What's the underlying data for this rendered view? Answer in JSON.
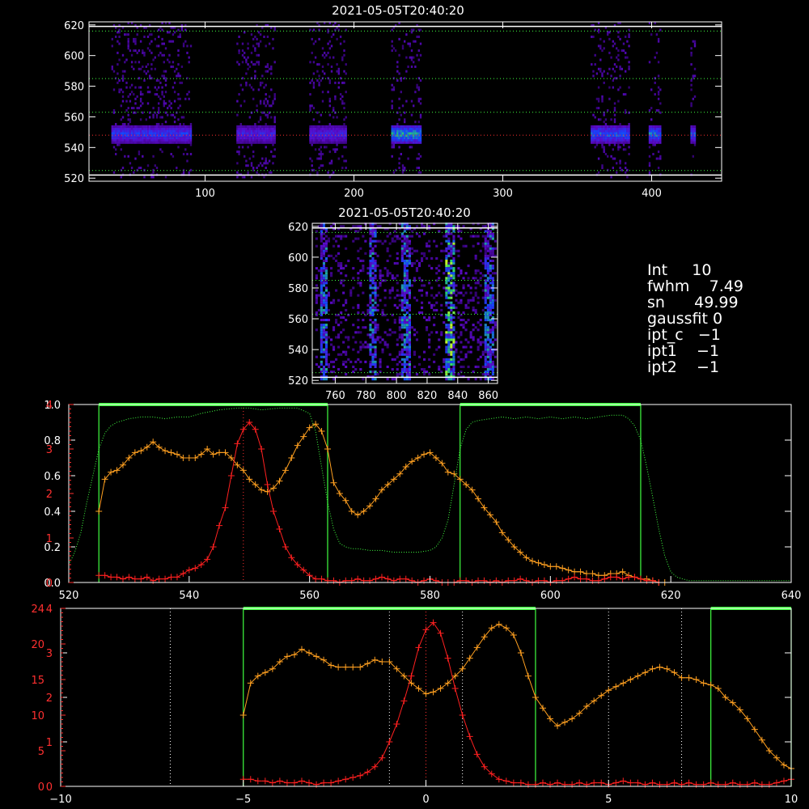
{
  "spectrogram_main": {
    "title": "2021-05-05T20:40:20",
    "xticks": [
      100,
      200,
      300,
      400
    ],
    "yticks": [
      520,
      540,
      560,
      580,
      600,
      620
    ],
    "hlines_green": [
      525,
      563,
      585,
      616
    ],
    "hline_red": 548,
    "hline_white": [
      522,
      619
    ],
    "blocks": [
      {
        "x0": 37,
        "x1": 90,
        "intensity": 0.55
      },
      {
        "x0": 121,
        "x1": 147,
        "intensity": 0.45
      },
      {
        "x0": 170,
        "x1": 194,
        "intensity": 0.45
      },
      {
        "x0": 225,
        "x1": 245,
        "intensity": 0.85
      },
      {
        "x0": 359,
        "x1": 385,
        "intensity": 0.65
      },
      {
        "x0": 398,
        "x1": 406,
        "intensity": 0.7
      },
      {
        "x0": 426,
        "x1": 429,
        "intensity": 0.6
      }
    ]
  },
  "spectrogram_small": {
    "title": "2021-05-05T20:40:20",
    "xticks": [
      760,
      780,
      800,
      820,
      840,
      860
    ],
    "yticks": [
      520,
      540,
      560,
      580,
      600,
      620
    ],
    "hlines_green": [
      525,
      563,
      585,
      616
    ],
    "hline_white": [
      522,
      619
    ],
    "columns": [
      752,
      784,
      806,
      834,
      860
    ]
  },
  "info": {
    "lines": [
      "Int     10",
      "fwhm    7.49",
      "sn      49.99",
      "gaussfit 0",
      "ipt_c   −1",
      "ipt1    −1",
      "ipt2    −1"
    ]
  },
  "chart_data": [
    {
      "type": "line",
      "xlim": [
        520,
        640
      ],
      "xticks": [
        520,
        540,
        560,
        580,
        600,
        620,
        640
      ],
      "left_ticks_white": [
        "0.0",
        "0.2",
        "0.4",
        "0.6",
        "0.8",
        "1.0"
      ],
      "left_ticks_red": [
        "0",
        "1",
        "2",
        "3",
        "4"
      ],
      "green_boxes": [
        [
          525,
          563
        ],
        [
          585,
          615
        ]
      ],
      "red_vline": 549,
      "series": [
        {
          "color": "#ffa020",
          "x": [
            525,
            526,
            527,
            528,
            529,
            530,
            531,
            532,
            533,
            534,
            535,
            536,
            537,
            538,
            539,
            540,
            541,
            542,
            543,
            544,
            545,
            546,
            547,
            548,
            549,
            550,
            551,
            552,
            553,
            554,
            555,
            556,
            557,
            558,
            559,
            560,
            561,
            562,
            563,
            564,
            565,
            566,
            567,
            568,
            569,
            570,
            571,
            572,
            573,
            574,
            575,
            576,
            577,
            578,
            579,
            580,
            581,
            582,
            583,
            584,
            585,
            586,
            587,
            588,
            589,
            590,
            591,
            592,
            593,
            594,
            595,
            596,
            597,
            598,
            599,
            600,
            601,
            602,
            603,
            604,
            605,
            606,
            607,
            608,
            609,
            610,
            611,
            612,
            613,
            614,
            615,
            616,
            617,
            618,
            619
          ],
          "y": [
            0.4,
            0.58,
            0.62,
            0.63,
            0.66,
            0.7,
            0.73,
            0.74,
            0.76,
            0.79,
            0.76,
            0.74,
            0.73,
            0.72,
            0.7,
            0.7,
            0.7,
            0.72,
            0.75,
            0.72,
            0.73,
            0.73,
            0.7,
            0.66,
            0.63,
            0.58,
            0.55,
            0.52,
            0.51,
            0.53,
            0.57,
            0.63,
            0.7,
            0.77,
            0.82,
            0.87,
            0.89,
            0.85,
            0.75,
            0.56,
            0.5,
            0.46,
            0.4,
            0.38,
            0.4,
            0.43,
            0.47,
            0.52,
            0.55,
            0.58,
            0.61,
            0.65,
            0.68,
            0.7,
            0.72,
            0.73,
            0.7,
            0.67,
            0.62,
            0.61,
            0.58,
            0.55,
            0.52,
            0.47,
            0.42,
            0.38,
            0.34,
            0.28,
            0.24,
            0.2,
            0.17,
            0.14,
            0.12,
            0.11,
            0.1,
            0.09,
            0.09,
            0.08,
            0.07,
            0.06,
            0.06,
            0.05,
            0.05,
            0.04,
            0.04,
            0.05,
            0.05,
            0.06,
            0.04,
            0.03,
            0.02,
            0.02,
            0.01,
            0.0,
            0.0
          ]
        },
        {
          "color": "#ff2020",
          "x": [
            525,
            526,
            527,
            528,
            529,
            530,
            531,
            532,
            533,
            534,
            535,
            536,
            537,
            538,
            539,
            540,
            541,
            542,
            543,
            544,
            545,
            546,
            547,
            548,
            549,
            550,
            551,
            552,
            553,
            554,
            555,
            556,
            557,
            558,
            559,
            560,
            561,
            562,
            563,
            564,
            565,
            566,
            567,
            568,
            569,
            570,
            571,
            572,
            573,
            574,
            575,
            576,
            577,
            578,
            579,
            580,
            581,
            582,
            583,
            584,
            585,
            586,
            587,
            588,
            589,
            590,
            591,
            592,
            593,
            594,
            595,
            596,
            597,
            598,
            599,
            600,
            601,
            602,
            603,
            604,
            605,
            606,
            607,
            608,
            609,
            610,
            611,
            612,
            613,
            614,
            615,
            616,
            617,
            618
          ],
          "y": [
            0.04,
            0.04,
            0.03,
            0.03,
            0.02,
            0.03,
            0.02,
            0.02,
            0.03,
            0.01,
            0.02,
            0.02,
            0.03,
            0.03,
            0.05,
            0.07,
            0.08,
            0.1,
            0.13,
            0.2,
            0.32,
            0.42,
            0.6,
            0.78,
            0.86,
            0.9,
            0.86,
            0.75,
            0.55,
            0.4,
            0.3,
            0.2,
            0.14,
            0.1,
            0.07,
            0.04,
            0.02,
            0.02,
            0.01,
            0.01,
            0.0,
            0.01,
            0.01,
            0.02,
            0.01,
            0.01,
            0.02,
            0.03,
            0.02,
            0.01,
            0.02,
            0.02,
            0.01,
            0.0,
            0.01,
            0.02,
            0.01,
            0.0,
            0.0,
            0.0,
            0.01,
            0.01,
            0.0,
            0.01,
            0.01,
            0.0,
            0.01,
            0.0,
            0.01,
            0.01,
            0.02,
            0.01,
            0.0,
            0.01,
            0.01,
            0.0,
            0.01,
            0.01,
            0.02,
            0.03,
            0.02,
            0.02,
            0.01,
            0.01,
            0.02,
            0.03,
            0.03,
            0.02,
            0.03,
            0.03,
            0.02,
            0.01,
            0.01,
            0.0
          ]
        },
        {
          "color": "#40ff40",
          "dotted": true,
          "x": [
            520,
            521,
            522,
            523,
            524,
            525,
            526,
            527,
            528,
            529,
            530,
            532,
            534,
            536,
            538,
            540,
            542,
            545,
            548,
            550,
            552,
            555,
            558,
            560,
            561,
            562,
            563,
            564,
            565,
            566,
            567,
            568,
            570,
            572,
            574,
            576,
            578,
            580,
            581,
            582,
            583,
            584,
            585,
            586,
            587,
            588,
            590,
            592,
            594,
            596,
            598,
            600,
            602,
            604,
            606,
            608,
            610,
            612,
            613,
            614,
            615,
            616,
            617,
            618,
            619,
            620,
            621,
            622,
            623,
            624,
            626,
            628,
            630,
            632,
            634,
            636,
            638,
            640
          ],
          "y": [
            0.1,
            0.17,
            0.28,
            0.45,
            0.6,
            0.75,
            0.84,
            0.88,
            0.9,
            0.91,
            0.92,
            0.93,
            0.93,
            0.92,
            0.93,
            0.93,
            0.95,
            0.97,
            0.98,
            0.98,
            0.97,
            0.98,
            0.98,
            0.95,
            0.85,
            0.65,
            0.45,
            0.3,
            0.22,
            0.2,
            0.19,
            0.19,
            0.18,
            0.18,
            0.17,
            0.17,
            0.17,
            0.18,
            0.2,
            0.25,
            0.35,
            0.55,
            0.75,
            0.86,
            0.9,
            0.91,
            0.92,
            0.93,
            0.92,
            0.93,
            0.92,
            0.93,
            0.92,
            0.93,
            0.92,
            0.93,
            0.94,
            0.94,
            0.92,
            0.88,
            0.8,
            0.65,
            0.48,
            0.3,
            0.15,
            0.06,
            0.03,
            0.02,
            0.01,
            0.01,
            0.01,
            0.01,
            0.01,
            0.01,
            0.01,
            0.01,
            0.01,
            0.01
          ]
        }
      ]
    },
    {
      "type": "line",
      "xlim": [
        -10,
        10
      ],
      "xticks": [
        "−10",
        "−5",
        "0",
        "5",
        "10"
      ],
      "xtick_vals": [
        -10,
        -5,
        0,
        5,
        10
      ],
      "left_ticks_red": [
        "0",
        "5",
        "10",
        "15",
        "20",
        "24"
      ],
      "left_ticks_white": [
        "0",
        "1",
        "2",
        "3",
        "4"
      ],
      "green_boxes": [
        [
          -5,
          3
        ],
        [
          7.8,
          10
        ]
      ],
      "white_vlines": [
        -7,
        -1,
        1,
        5,
        7
      ],
      "red_vline": 0,
      "series": [
        {
          "color": "#ffa020",
          "x": [
            -5.0,
            -4.8,
            -4.6,
            -4.4,
            -4.2,
            -4.0,
            -3.8,
            -3.6,
            -3.4,
            -3.2,
            -3.0,
            -2.8,
            -2.6,
            -2.4,
            -2.2,
            -2.0,
            -1.8,
            -1.6,
            -1.4,
            -1.2,
            -1.0,
            -0.8,
            -0.6,
            -0.4,
            -0.2,
            0.0,
            0.2,
            0.4,
            0.6,
            0.8,
            1.0,
            1.2,
            1.4,
            1.6,
            1.8,
            2.0,
            2.2,
            2.4,
            2.6,
            2.8,
            3.0,
            3.2,
            3.4,
            3.6,
            3.8,
            4.0,
            4.2,
            4.4,
            4.6,
            4.8,
            5.0,
            5.2,
            5.4,
            5.6,
            5.8,
            6.0,
            6.2,
            6.4,
            6.6,
            6.8,
            7.0,
            7.2,
            7.4,
            7.6,
            7.8,
            8.0,
            8.2,
            8.4,
            8.6,
            8.8,
            9.0,
            9.2,
            9.4,
            9.6,
            9.8,
            10.0
          ],
          "y": [
            0.4,
            0.58,
            0.62,
            0.64,
            0.66,
            0.7,
            0.73,
            0.74,
            0.77,
            0.75,
            0.73,
            0.71,
            0.68,
            0.67,
            0.67,
            0.67,
            0.67,
            0.69,
            0.71,
            0.7,
            0.7,
            0.66,
            0.62,
            0.58,
            0.55,
            0.52,
            0.53,
            0.55,
            0.58,
            0.62,
            0.66,
            0.72,
            0.78,
            0.84,
            0.89,
            0.91,
            0.89,
            0.85,
            0.75,
            0.62,
            0.5,
            0.44,
            0.38,
            0.34,
            0.36,
            0.38,
            0.41,
            0.45,
            0.48,
            0.51,
            0.54,
            0.56,
            0.58,
            0.6,
            0.62,
            0.64,
            0.66,
            0.67,
            0.66,
            0.64,
            0.61,
            0.61,
            0.6,
            0.58,
            0.57,
            0.55,
            0.5,
            0.47,
            0.43,
            0.38,
            0.32,
            0.26,
            0.2,
            0.16,
            0.12,
            0.1
          ]
        },
        {
          "color": "#ff2020",
          "x": [
            -5.0,
            -4.8,
            -4.6,
            -4.4,
            -4.2,
            -4.0,
            -3.8,
            -3.6,
            -3.4,
            -3.2,
            -3.0,
            -2.8,
            -2.6,
            -2.4,
            -2.2,
            -2.0,
            -1.8,
            -1.6,
            -1.4,
            -1.2,
            -1.0,
            -0.8,
            -0.6,
            -0.4,
            -0.2,
            0.0,
            0.2,
            0.4,
            0.6,
            0.8,
            1.0,
            1.2,
            1.4,
            1.6,
            1.8,
            2.0,
            2.2,
            2.4,
            2.6,
            2.8,
            3.0,
            3.2,
            3.4,
            3.6,
            3.8,
            4.0,
            4.2,
            4.4,
            4.6,
            4.8,
            5.0,
            5.2,
            5.4,
            5.6,
            5.8,
            6.0,
            6.2,
            6.4,
            6.6,
            6.8,
            7.0,
            7.2,
            7.4,
            7.6,
            7.8,
            8.0,
            8.2,
            8.4,
            8.6,
            8.8,
            9.0,
            9.2,
            9.4,
            9.6,
            9.8,
            10.0
          ],
          "y": [
            0.04,
            0.04,
            0.03,
            0.03,
            0.02,
            0.03,
            0.02,
            0.02,
            0.03,
            0.02,
            0.01,
            0.02,
            0.02,
            0.03,
            0.04,
            0.05,
            0.06,
            0.08,
            0.11,
            0.16,
            0.25,
            0.35,
            0.48,
            0.62,
            0.78,
            0.88,
            0.92,
            0.86,
            0.72,
            0.55,
            0.4,
            0.28,
            0.18,
            0.11,
            0.07,
            0.04,
            0.03,
            0.02,
            0.02,
            0.01,
            0.01,
            0.02,
            0.01,
            0.02,
            0.01,
            0.01,
            0.02,
            0.01,
            0.02,
            0.02,
            0.01,
            0.02,
            0.03,
            0.02,
            0.02,
            0.01,
            0.02,
            0.01,
            0.01,
            0.02,
            0.01,
            0.02,
            0.01,
            0.01,
            0.02,
            0.01,
            0.01,
            0.02,
            0.01,
            0.01,
            0.02,
            0.01,
            0.01,
            0.02,
            0.03,
            0.04
          ]
        }
      ]
    }
  ]
}
